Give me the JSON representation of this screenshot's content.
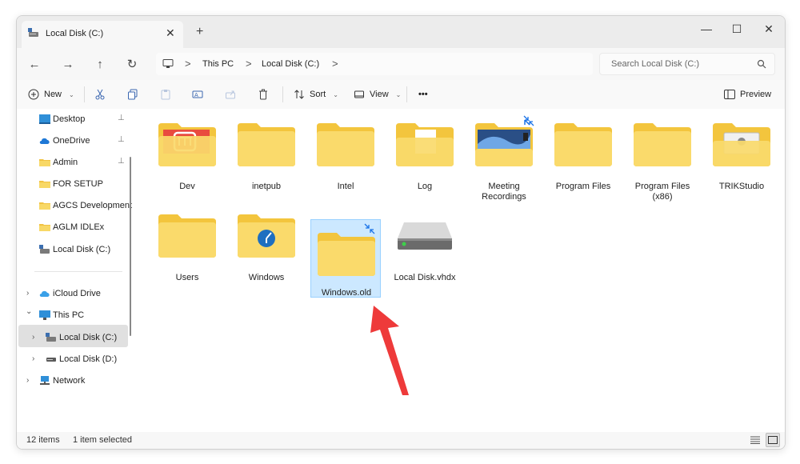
{
  "window": {
    "tab_title": "Local Disk (C:)",
    "tab_close": "✕",
    "new_tab": "+",
    "controls": {
      "minimize": "—",
      "maximize": "☐",
      "close": "✕"
    }
  },
  "nav": {
    "back": "←",
    "forward": "→",
    "up": "↑",
    "refresh": "↻",
    "breadcrumb": [
      "This PC",
      "Local Disk (C:)"
    ],
    "separator": ">",
    "search_placeholder": "Search Local Disk (C:)"
  },
  "toolbar": {
    "new_label": "New",
    "sort_label": "Sort",
    "view_label": "View",
    "more_label": "•••",
    "preview_label": "Preview"
  },
  "sidebar": {
    "quick_access": [
      {
        "label": "Desktop",
        "icon": "desktop-icon",
        "pinned": true
      },
      {
        "label": "OneDrive",
        "icon": "cloud-icon",
        "pinned": true
      },
      {
        "label": "Admin",
        "icon": "folder-icon",
        "pinned": true
      },
      {
        "label": "FOR SETUP",
        "icon": "folder-icon",
        "pinned": false
      },
      {
        "label": "AGCS Development",
        "icon": "folder-icon",
        "pinned": false
      },
      {
        "label": "AGLM IDLEx",
        "icon": "folder-icon",
        "pinned": false
      },
      {
        "label": "Local Disk (C:)",
        "icon": "drive-icon",
        "pinned": false
      }
    ],
    "tree": [
      {
        "label": "iCloud Drive",
        "icon": "icloud-icon",
        "chevron": "›"
      },
      {
        "label": "This PC",
        "icon": "pc-icon",
        "chevron": "⌄"
      },
      {
        "label": "Local Disk (C:)",
        "icon": "drive-icon",
        "chevron": "›"
      },
      {
        "label": "Local Disk (D:)",
        "icon": "drive-icon",
        "chevron": "›"
      },
      {
        "label": "Network",
        "icon": "network-icon",
        "chevron": "›"
      }
    ],
    "pin_glyph": "📌"
  },
  "items": [
    {
      "label": "Dev",
      "type": "folder-dev"
    },
    {
      "label": "inetpub",
      "type": "folder"
    },
    {
      "label": "Intel",
      "type": "folder"
    },
    {
      "label": "Log",
      "type": "folder-doc"
    },
    {
      "label": "Meeting Recordings",
      "type": "folder-recordings"
    },
    {
      "label": "Program Files",
      "type": "folder"
    },
    {
      "label": "Program Files (x86)",
      "type": "folder"
    },
    {
      "label": "TRIKStudio",
      "type": "folder-trik"
    },
    {
      "label": "Users",
      "type": "folder"
    },
    {
      "label": "Windows",
      "type": "folder-windows"
    },
    {
      "label": "Windows.old",
      "type": "folder-compressed",
      "selected": true
    },
    {
      "label": "Local Disk.vhdx",
      "type": "vhdx"
    }
  ],
  "status": {
    "count": "12 items",
    "selection": "1 item selected"
  },
  "colors": {
    "folder_back": "#F3C53D",
    "folder_front": "#FADA6B",
    "selection": "#CCE8FF",
    "selection_border": "#99D1FF",
    "arrow": "#EE3A3A"
  }
}
